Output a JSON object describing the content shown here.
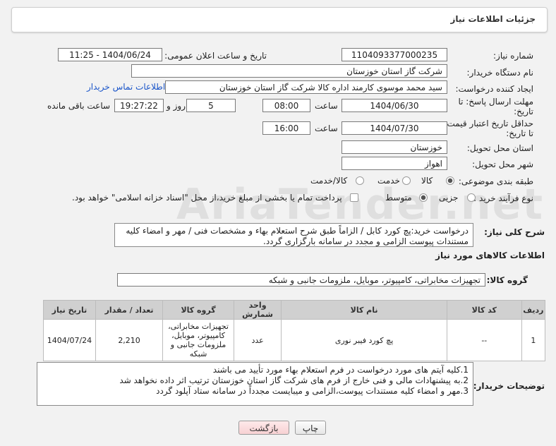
{
  "header": {
    "title": "جزئیات اطلاعات نیاز"
  },
  "form": {
    "need_number_label": "شماره نیاز:",
    "need_number": "1104093377000235",
    "announce_label": "تاریخ و ساعت اعلان عمومی:",
    "announce_value": "1404/06/24 - 11:25",
    "buyer_org_label": "نام دستگاه خریدار:",
    "buyer_org": "شرکت گاز استان خوزستان",
    "creator_label": "ایجاد کننده درخواست:",
    "creator": "سید محمد موسوی کارمند اداره کالا شرکت گاز استان خوزستان",
    "contact_link": "اطلاعات تماس خریدار",
    "deadline_label_1": "مهلت ارسال پاسخ: تا",
    "deadline_label_2": "تاریخ:",
    "deadline_date": "1404/06/30",
    "time_label": "ساعت",
    "deadline_time": "08:00",
    "days": "5",
    "days_label": "روز و",
    "remaining_time": "19:27:22",
    "remaining_label": "ساعت باقی مانده",
    "validity_label_1": "حداقل تاریخ اعتبار قیمت:",
    "validity_label_2": "تا تاریخ:",
    "validity_date": "1404/07/30",
    "validity_time": "16:00",
    "province_label": "استان محل تحویل:",
    "province": "خوزستان",
    "city_label": "شهر محل تحویل:",
    "city": "اهواز",
    "category_label": "طبقه بندی موضوعی:",
    "category_options": [
      "کالا",
      "خدمت",
      "کالا/خدمت"
    ],
    "process_label": "نوع فرآیند خرید :",
    "process_options": [
      "جزیی",
      "متوسط"
    ],
    "payment_note": "پرداخت تمام یا بخشی از مبلغ خرید،از محل \"اسناد خزانه اسلامی\" خواهد بود.",
    "description_label": "شرح کلی نیاز:",
    "description": "درخواست خرید:پچ کورد کابل / الزاماً طبق شرح استعلام بهاء و مشخصات فنی / مهر و امضاء کلیه مستندات پیوست الزامی و مجدد در سامانه بارگزاری گردد."
  },
  "goods": {
    "section_title": "اطلاعات کالاهای مورد نیاز",
    "group_label": "گروه کالا:",
    "group_value": "تجهیزات مخابراتی، کامپیوتر، موبایل، ملزومات جانبی و شبکه",
    "columns": [
      "ردیف",
      "کد کالا",
      "نام کالا",
      "واحد شمارش",
      "گروه کالا",
      "تعداد / مقدار",
      "تاریخ نیاز"
    ],
    "rows": [
      {
        "row": "1",
        "code": "--",
        "name": "پچ کورد فیبر نوری",
        "unit": "عدد",
        "group": "تجهیزات مخابراتی، کامپیوتر، موبایل، ملزومات جانبی و شبکه",
        "qty": "2,210",
        "date": "1404/07/24"
      }
    ]
  },
  "notes": {
    "label": "توضیحات خریدار:",
    "text": "1.کلیه آیتم های مورد درخواست در فرم استعلام بهاء مورد تأیید می باشند\n2.به پیشنهادات مالی و فنی خارج از فرم های شرکت گاز استان خوزستان ترتیب اثر داده نخواهد شد\n3.مهر و امضاء کلیه مستندات پیوست،الزامی و میبایست مجدداً در سامانه ستاد آپلود گردد"
  },
  "buttons": {
    "print": "چاپ",
    "back": "بازگشت"
  },
  "watermark": "AriaTender.net"
}
